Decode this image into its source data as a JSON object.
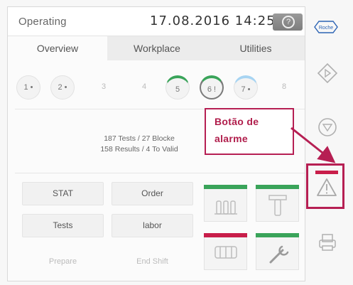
{
  "status": {
    "state": "Operating",
    "datetime": "17.08.2016 14:25"
  },
  "brand": {
    "logo_text": "Roche"
  },
  "tabs": [
    {
      "label": "Overview",
      "active": true
    },
    {
      "label": "Workplace",
      "active": false
    },
    {
      "label": "Utilities",
      "active": false
    }
  ],
  "modules": [
    {
      "label": "1 •",
      "state": "idle"
    },
    {
      "label": "2 •",
      "state": "idle"
    },
    {
      "label": "3",
      "state": "empty"
    },
    {
      "label": "4",
      "state": "empty"
    },
    {
      "label": "5",
      "state": "green"
    },
    {
      "label": "6 !",
      "state": "green-selected"
    },
    {
      "label": "7 •",
      "state": "blue"
    },
    {
      "label": "8",
      "state": "empty"
    }
  ],
  "summary": {
    "line1": "187 Tests / 27 Blocke",
    "line2": "158 Results / 4 To Valid"
  },
  "buttons": {
    "stat": "STAT",
    "order": "Order",
    "tests": "Tests",
    "labor": "labor",
    "prepare": "Prepare",
    "end_shift": "End Shift"
  },
  "tiles": {
    "reagents": {
      "icon": "reagent-tubes-icon",
      "status_color": "#3aa45a"
    },
    "tools": {
      "icon": "t-tool-icon",
      "status_color": "#3aa45a"
    },
    "samples": {
      "icon": "sample-rack-icon",
      "status_color": "#c81e4a"
    },
    "maintenance": {
      "icon": "wrench-icon",
      "status_color": "#3aa45a"
    }
  },
  "side_icons": {
    "start": "diamond-arrow-icon",
    "stop": "circle-down-icon",
    "alarm": "warning-triangle-icon",
    "alarm_color": "#c81e4a",
    "print": "printer-icon"
  },
  "annotation": {
    "line1": "Botão de",
    "line2": "alarme",
    "color": "#b01d4b"
  }
}
